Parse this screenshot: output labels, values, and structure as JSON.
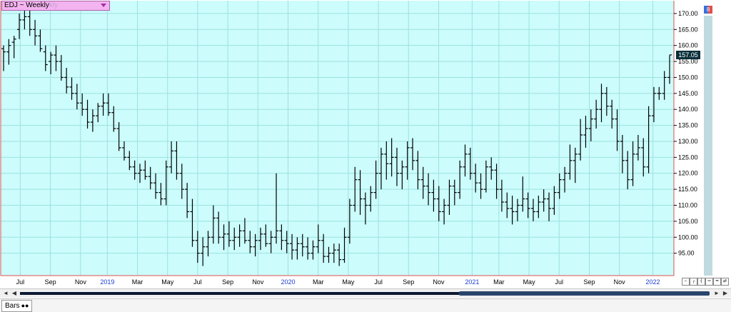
{
  "window": {
    "symbol_label": "EDJ ~ Weekly",
    "symbol_ghost": "kly",
    "corner_badge": "8"
  },
  "price_marker": {
    "label": "157.05"
  },
  "footer": {
    "tab_label": "Bars",
    "tab_icon": "link-icon"
  },
  "scrollbar": {
    "left_icon": "scroll-left-icon",
    "right_icon": "scroll-right-icon"
  },
  "toolbar_icons": [
    "zoom-icon",
    "bar-type-icon",
    "range-icon",
    "fit-icon",
    "grid-icon",
    "reset-icon"
  ],
  "colors": {
    "plot_bg": "#ccfcfc",
    "grid": "#9fe0e0",
    "bar": "#000000",
    "border": "#e05050",
    "year_label": "#1a3cd6",
    "tick_label": "#000000"
  },
  "chart_data": {
    "type": "ohlc",
    "title": "",
    "xlabel": "",
    "ylabel": "",
    "ylim": [
      88,
      174
    ],
    "y_ticks": [
      95,
      100,
      105,
      110,
      115,
      120,
      125,
      130,
      135,
      140,
      145,
      150,
      155,
      160,
      165,
      170
    ],
    "y_tick_labels": [
      "95.00",
      "100.00",
      "105.00",
      "110.00",
      "115.00",
      "120.00",
      "125.00",
      "130.00",
      "135.00",
      "140.00",
      "145.00",
      "150.00",
      "155.00",
      "160.00",
      "165.00",
      "170.00"
    ],
    "x_labels": [
      {
        "text": "Jul",
        "week": 5,
        "year": false
      },
      {
        "text": "Sep",
        "week": 14,
        "year": false
      },
      {
        "text": "Nov",
        "week": 23,
        "year": false
      },
      {
        "text": "2019",
        "week": 31,
        "year": true
      },
      {
        "text": "Mar",
        "week": 40,
        "year": false
      },
      {
        "text": "May",
        "week": 49,
        "year": false
      },
      {
        "text": "Jul",
        "week": 58,
        "year": false
      },
      {
        "text": "Sep",
        "week": 67,
        "year": false
      },
      {
        "text": "Nov",
        "week": 76,
        "year": false
      },
      {
        "text": "2020",
        "week": 85,
        "year": true
      },
      {
        "text": "Mar",
        "week": 94,
        "year": false
      },
      {
        "text": "May",
        "week": 103,
        "year": false
      },
      {
        "text": "Jul",
        "week": 112,
        "year": false
      },
      {
        "text": "Sep",
        "week": 121,
        "year": false
      },
      {
        "text": "Nov",
        "week": 130,
        "year": false
      },
      {
        "text": "2021",
        "week": 140,
        "year": true
      },
      {
        "text": "Mar",
        "week": 148,
        "year": false
      },
      {
        "text": "May",
        "week": 157,
        "year": false
      },
      {
        "text": "Jul",
        "week": 166,
        "year": false
      },
      {
        "text": "Sep",
        "week": 175,
        "year": false
      },
      {
        "text": "Nov",
        "week": 184,
        "year": false
      },
      {
        "text": "2022",
        "week": 194,
        "year": true
      }
    ],
    "weeks": 200,
    "last_price": 157.05,
    "bars": [
      [
        159,
        160,
        152,
        158
      ],
      [
        158,
        162,
        154,
        160
      ],
      [
        161,
        163,
        156,
        162
      ],
      [
        165,
        170,
        162,
        168
      ],
      [
        168,
        172,
        165,
        169
      ],
      [
        169,
        171,
        163,
        165
      ],
      [
        165,
        168,
        160,
        163
      ],
      [
        163,
        165,
        158,
        159
      ],
      [
        158,
        160,
        152,
        154
      ],
      [
        155,
        158,
        151,
        157
      ],
      [
        157,
        160,
        152,
        155
      ],
      [
        155,
        157,
        149,
        150
      ],
      [
        150,
        153,
        145,
        147
      ],
      [
        147,
        150,
        143,
        145
      ],
      [
        145,
        148,
        140,
        142
      ],
      [
        142,
        145,
        138,
        140
      ],
      [
        140,
        143,
        134,
        136
      ],
      [
        136,
        140,
        133,
        138
      ],
      [
        138,
        142,
        136,
        141
      ],
      [
        141,
        145,
        138,
        142
      ],
      [
        142,
        145,
        138,
        139
      ],
      [
        139,
        141,
        133,
        134
      ],
      [
        134,
        136,
        127,
        128
      ],
      [
        128,
        130,
        124,
        125
      ],
      [
        125,
        127,
        121,
        122
      ],
      [
        122,
        124,
        118,
        120
      ],
      [
        120,
        123,
        117,
        121
      ],
      [
        121,
        124,
        118,
        119
      ],
      [
        119,
        122,
        115,
        117
      ],
      [
        117,
        120,
        112,
        114
      ],
      [
        114,
        117,
        110,
        112
      ],
      [
        112,
        124,
        110,
        122
      ],
      [
        122,
        130,
        120,
        127
      ],
      [
        127,
        130,
        118,
        120
      ],
      [
        120,
        123,
        112,
        115
      ],
      [
        115,
        117,
        106,
        108
      ],
      [
        108,
        112,
        97,
        99
      ],
      [
        99,
        102,
        92,
        95
      ],
      [
        95,
        100,
        91,
        97
      ],
      [
        97,
        102,
        94,
        100
      ],
      [
        100,
        110,
        98,
        106
      ],
      [
        106,
        108,
        98,
        100
      ],
      [
        100,
        104,
        96,
        101
      ],
      [
        101,
        105,
        97,
        99
      ],
      [
        99,
        103,
        96,
        100
      ],
      [
        100,
        104,
        97,
        102
      ],
      [
        102,
        106,
        98,
        99
      ],
      [
        99,
        102,
        95,
        97
      ],
      [
        97,
        101,
        94,
        99
      ],
      [
        99,
        103,
        96,
        101
      ],
      [
        101,
        104,
        97,
        98
      ],
      [
        98,
        102,
        95,
        100
      ],
      [
        100,
        120,
        98,
        102
      ],
      [
        102,
        104,
        96,
        99
      ],
      [
        99,
        102,
        95,
        98
      ],
      [
        98,
        101,
        93,
        96
      ],
      [
        96,
        100,
        93,
        98
      ],
      [
        98,
        101,
        94,
        97
      ],
      [
        97,
        100,
        93,
        95
      ],
      [
        95,
        99,
        93,
        97
      ],
      [
        97,
        104,
        95,
        99
      ],
      [
        99,
        101,
        92,
        94
      ],
      [
        94,
        97,
        92,
        95
      ],
      [
        95,
        98,
        92,
        96
      ],
      [
        96,
        98,
        91,
        93
      ],
      [
        93,
        103,
        92,
        100
      ],
      [
        100,
        112,
        98,
        110
      ],
      [
        110,
        122,
        108,
        118
      ],
      [
        118,
        121,
        107,
        112
      ],
      [
        112,
        114,
        104,
        110
      ],
      [
        110,
        116,
        108,
        114
      ],
      [
        114,
        124,
        112,
        120
      ],
      [
        120,
        128,
        115,
        126
      ],
      [
        126,
        130,
        118,
        123
      ],
      [
        123,
        131,
        119,
        125
      ],
      [
        125,
        128,
        116,
        120
      ],
      [
        120,
        124,
        115,
        122
      ],
      [
        122,
        130,
        118,
        128
      ],
      [
        128,
        131,
        121,
        124
      ],
      [
        124,
        127,
        115,
        118
      ],
      [
        118,
        122,
        112,
        116
      ],
      [
        116,
        120,
        110,
        114
      ],
      [
        114,
        118,
        108,
        112
      ],
      [
        112,
        116,
        105,
        108
      ],
      [
        108,
        112,
        104,
        110
      ],
      [
        110,
        118,
        107,
        116
      ],
      [
        116,
        118,
        110,
        114
      ],
      [
        114,
        124,
        112,
        122
      ],
      [
        122,
        129,
        119,
        126
      ],
      [
        126,
        128,
        118,
        120
      ],
      [
        120,
        123,
        114,
        117
      ],
      [
        117,
        120,
        112,
        115
      ],
      [
        115,
        124,
        114,
        122
      ],
      [
        122,
        125,
        118,
        121
      ],
      [
        121,
        123,
        112,
        115
      ],
      [
        115,
        118,
        108,
        111
      ],
      [
        111,
        114,
        106,
        109
      ],
      [
        109,
        113,
        104,
        108
      ],
      [
        108,
        112,
        105,
        110
      ],
      [
        110,
        119,
        108,
        112
      ],
      [
        112,
        114,
        106,
        109
      ],
      [
        109,
        112,
        105,
        108
      ],
      [
        108,
        113,
        106,
        111
      ],
      [
        111,
        115,
        108,
        112
      ],
      [
        112,
        114,
        105,
        109
      ],
      [
        109,
        116,
        107,
        114
      ],
      [
        114,
        120,
        112,
        118
      ],
      [
        118,
        122,
        114,
        120
      ],
      [
        120,
        129,
        118,
        124
      ],
      [
        124,
        128,
        117,
        126
      ],
      [
        126,
        137,
        124,
        132
      ],
      [
        132,
        138,
        128,
        134
      ],
      [
        134,
        140,
        130,
        137
      ],
      [
        137,
        143,
        134,
        140
      ],
      [
        140,
        148,
        136,
        145
      ],
      [
        145,
        147,
        138,
        141
      ],
      [
        141,
        143,
        134,
        137
      ],
      [
        137,
        140,
        127,
        130
      ],
      [
        130,
        132,
        120,
        124
      ],
      [
        124,
        127,
        115,
        118
      ],
      [
        118,
        130,
        116,
        126
      ],
      [
        126,
        132,
        124,
        128
      ],
      [
        128,
        131,
        119,
        122
      ],
      [
        122,
        141,
        120,
        138
      ],
      [
        138,
        147,
        136,
        145
      ],
      [
        145,
        147,
        143,
        145
      ],
      [
        145,
        152,
        143,
        150
      ],
      [
        150,
        157,
        148,
        157.05
      ]
    ]
  }
}
